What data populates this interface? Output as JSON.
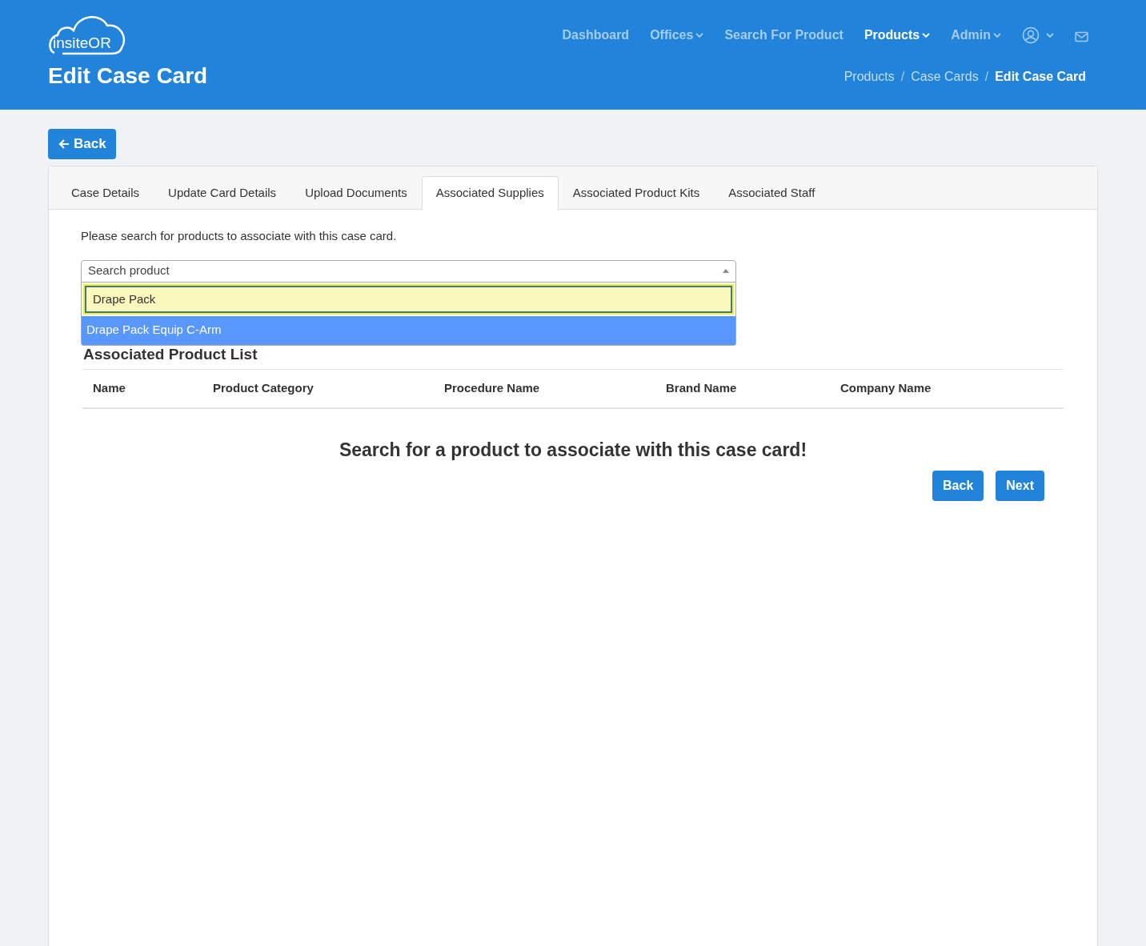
{
  "header": {
    "logo": "insiteOR",
    "title": "Edit Case Card",
    "nav": [
      {
        "kind": "link",
        "label": "Dashboard",
        "selected": false,
        "dropdown": false
      },
      {
        "kind": "link",
        "label": "Offices",
        "selected": false,
        "dropdown": true
      },
      {
        "kind": "link",
        "label": "Search For Product",
        "selected": false,
        "dropdown": false
      },
      {
        "kind": "link",
        "label": "Products",
        "selected": true,
        "dropdown": true
      },
      {
        "kind": "link",
        "label": "Admin",
        "selected": false,
        "dropdown": true
      },
      {
        "kind": "user",
        "selected": false,
        "dropdown": true
      },
      {
        "kind": "mail",
        "selected": false,
        "dropdown": false
      }
    ],
    "breadcrumb": [
      "Products",
      "Case Cards",
      "Edit Case Card"
    ],
    "breadcrumb_separator": "/"
  },
  "back_button": "Back",
  "tabs": [
    {
      "label": "Case Details",
      "selected": false
    },
    {
      "label": "Update Card Details",
      "selected": false
    },
    {
      "label": "Upload Documents",
      "selected": false
    },
    {
      "label": "Associated Supplies",
      "selected": true
    },
    {
      "label": "Associated Product Kits",
      "selected": false
    },
    {
      "label": "Associated Staff",
      "selected": false
    }
  ],
  "instructions": "Please search for products to associate with this case card.",
  "product_select": {
    "placeholder": "Search product",
    "expanded": true,
    "search_value": "Drape Pack",
    "options": [
      {
        "label": "Drape Pack Equip C-Arm",
        "selected": true
      }
    ]
  },
  "list_title": "Associated Product List",
  "table": {
    "columns": [
      "Name",
      "Product Category",
      "Procedure Name",
      "Brand Name",
      "Company Name"
    ]
  },
  "empty_message": "Search for a product to associate with this case card!",
  "footer_buttons": [
    "Back",
    "Next"
  ]
}
